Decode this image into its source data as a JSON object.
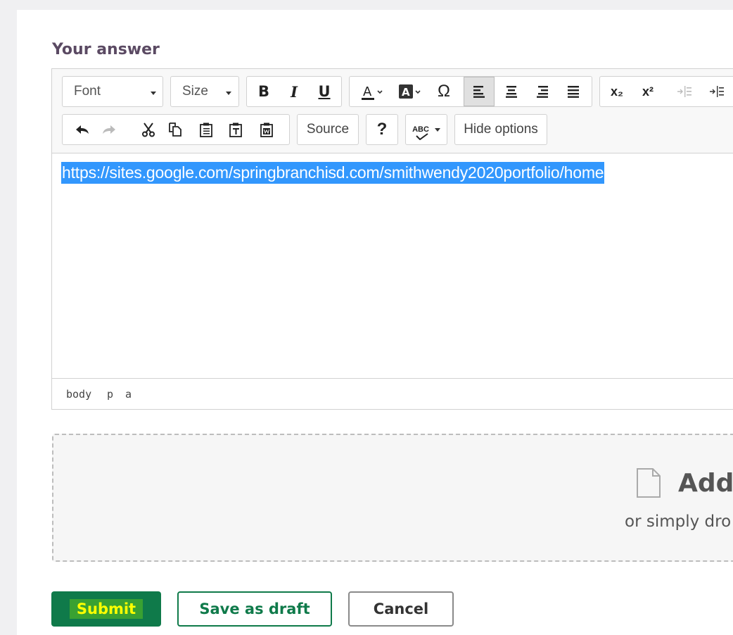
{
  "heading": "Your answer",
  "toolbar": {
    "font_label": "Font",
    "size_label": "Size",
    "bold": "B",
    "italic": "I",
    "underline": "U",
    "special_char": "Ω",
    "subscript": "x₂",
    "superscript": "x²",
    "source_label": "Source",
    "help_label": "?",
    "spellcheck_label": "ABC",
    "hide_options_label": "Hide options"
  },
  "editor": {
    "content": "https://sites.google.com/springbranchisd.com/smithwendy2020portfolio/home",
    "path": [
      "body",
      "p",
      "a"
    ]
  },
  "dropzone": {
    "title": "Add",
    "subtitle": "or simply dro"
  },
  "actions": {
    "submit": "Submit",
    "save_draft": "Save as draft",
    "cancel": "Cancel"
  },
  "colors": {
    "heading": "#5b4a63",
    "primary_green": "#0f7a4a",
    "selection_blue": "#3297fd"
  }
}
